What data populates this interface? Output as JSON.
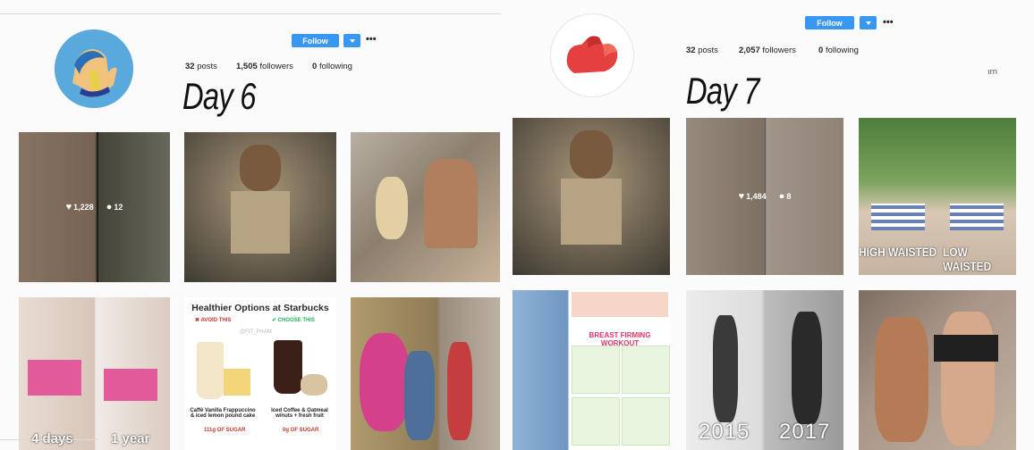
{
  "day6": {
    "follow_label": "Follow",
    "more_label": "•••",
    "posts_count": "32",
    "posts_label": "posts",
    "followers_count": "1,505",
    "followers_label": "followers",
    "following_count": "0",
    "following_label": "following",
    "day_label": "Day 6",
    "tiles": [
      {
        "likes": "1,228",
        "comments": "12"
      },
      {
        "title": "Healthier Options at Starbucks",
        "avoid": "AVOID THIS",
        "choose": "CHOOSE THIS",
        "handle": "@FIT_PHAM",
        "left_caption": "Caffè Vanilla Frappuccino & iced lemon pound cake",
        "right_caption": "Iced Coffee & Oatmeal w/nuts + fresh fruit",
        "left_sugar": "111g OF SUGAR",
        "right_sugar": "0g OF SUGAR"
      },
      {
        "caption_left": "4 days",
        "caption_right": "1 year"
      }
    ]
  },
  "day7": {
    "follow_label": "Follow",
    "more_label": "•••",
    "posts_count": "32",
    "posts_label": "posts",
    "followers_count": "2,057",
    "followers_label": "followers",
    "following_count": "0",
    "following_label": "following",
    "side_fragment": "ırn",
    "day_label": "Day 7",
    "tiles": [
      {
        "likes": "1,484",
        "comments": "8"
      },
      {
        "left_label": "HIGH WAISTED",
        "right_label": "LOW WAISTED"
      },
      {
        "workout_title": "BREAST FIRMING WORKOUT"
      },
      {
        "year_left": "2015",
        "year_right": "2017"
      }
    ]
  },
  "colors": {
    "follow_blue": "#3897f0",
    "background": "#fafafa"
  }
}
